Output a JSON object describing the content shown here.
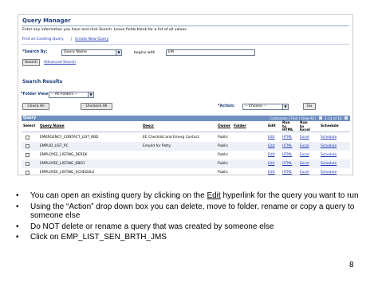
{
  "screen": {
    "title": "Query Manager",
    "instructions": "Enter any information you have and click Search. Leave fields blank for a list of all values.",
    "tabs": [
      {
        "label": "Find an Existing Query"
      },
      {
        "label": "Create New Query"
      }
    ],
    "search": {
      "label": "*Search By:",
      "by_value": "Query Name",
      "condition_label": "begins with",
      "value": "EM",
      "search_button": "Search",
      "advanced_link": "Advanced Search"
    },
    "results": {
      "title": "Search Results",
      "folder_label": "*Folder View:",
      "folder_value": "-- All Folders --",
      "check_all": "Check All",
      "uncheck_all": "Uncheck All",
      "action_label": "*Action:",
      "action_value": "-- Choose --",
      "go_button": "Go"
    },
    "grid": {
      "header": "Query",
      "header_links": "Customize | Find | View All |",
      "pager": "1-14 of 14",
      "columns": [
        "Select",
        "Query Name",
        "Descr",
        "Owner",
        "Folder",
        "Edit",
        "Run to HTML",
        "Run to Excel",
        "Schedule"
      ],
      "rows": [
        {
          "name": "EMERGENCY_CONTACT_LIST_KBD",
          "descr": "EE Checklist and Emerg Contact",
          "owner": "Public",
          "edit": "Edit",
          "html": "HTML",
          "excel": "Excel",
          "schedule": "Schedule"
        },
        {
          "name": "EMPLID_LIST_PC",
          "descr": "Emplid for Patty",
          "owner": "Public",
          "edit": "Edit",
          "html": "HTML",
          "excel": "Excel",
          "schedule": "Schedule"
        },
        {
          "name": "EMPLOYEE_LISTING_DEREK",
          "descr": "",
          "owner": "Public",
          "edit": "Edit",
          "html": "HTML",
          "excel": "Excel",
          "schedule": "Schedule"
        },
        {
          "name": "EMPLOYEE_LISTING_KBD1",
          "descr": "",
          "owner": "Public",
          "edit": "Edit",
          "html": "HTML",
          "excel": "Excel",
          "schedule": "Schedule"
        },
        {
          "name": "EMPLOYEE_LISTING_SCHEDULE",
          "descr": "",
          "owner": "Public",
          "edit": "Edit",
          "html": "HTML",
          "excel": "Excel",
          "schedule": "Schedule"
        }
      ]
    }
  },
  "bullets": [
    {
      "pre": "You can open an existing query by clicking on the ",
      "link": "Edit",
      "post": " hyperlink for the query you want to run"
    },
    {
      "text": "Using the “Action” drop down box you can delete, move to folder, rename or copy a query to someone else"
    },
    {
      "text": "Do NOT delete or rename a query that was created by someone else"
    },
    {
      "text": "Click on EMP_LIST_SEN_BRTH_JMS"
    }
  ],
  "page_number": "8",
  "colors": {
    "header_blue": "#1f3f7a",
    "link_blue": "#1a35b8",
    "grid_header": "#6e8fbf",
    "alt_row": "#eef2f8"
  }
}
